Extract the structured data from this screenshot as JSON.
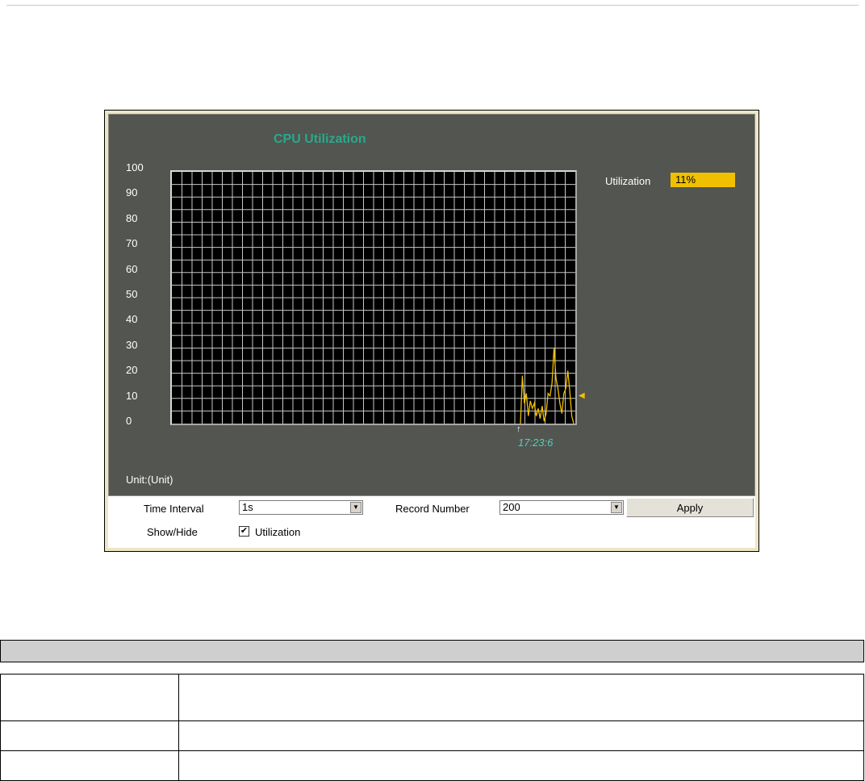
{
  "chart_data": {
    "type": "line",
    "title": "CPU Utilization",
    "y_ticks": [
      "100",
      "90",
      "80",
      "70",
      "60",
      "50",
      "40",
      "30",
      "20",
      "10",
      "0"
    ],
    "ylim": [
      0,
      100
    ],
    "grid": true,
    "series": [
      {
        "name": "Utilization",
        "color": "#f0c000",
        "x_start_index": 0,
        "values": [
          0,
          19,
          8,
          12,
          3,
          9,
          6,
          8,
          3,
          6,
          2,
          7,
          1,
          4,
          12,
          11,
          16,
          30,
          18,
          14,
          8,
          4,
          12,
          14,
          21,
          13,
          3,
          0
        ]
      }
    ],
    "current_marker_value": 11,
    "time_label": "17:23:6",
    "unit_label": "Unit:(Unit)"
  },
  "legend": {
    "label": "Utilization",
    "value": "11%",
    "color": "#f0c000"
  },
  "controls": {
    "time_interval_label": "Time Interval",
    "time_interval_value": "1s",
    "record_number_label": "Record Number",
    "record_number_value": "200",
    "apply_label": "Apply",
    "show_hide_label": "Show/Hide",
    "utilization_checkbox_label": "Utilization",
    "utilization_checked": true,
    "checkmark": "✔",
    "dropdown_arrow": "▼"
  }
}
